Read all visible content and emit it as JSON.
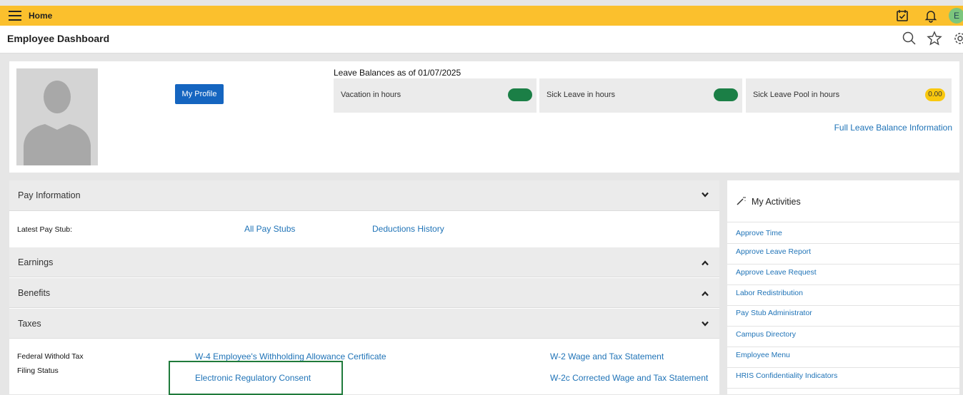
{
  "topbar": {
    "menu_icon": "hamburger-icon",
    "home_label": "Home",
    "avatar_initial": "E"
  },
  "header": {
    "title": "Employee Dashboard",
    "icons": [
      "search-icon",
      "star-icon",
      "gear-icon"
    ]
  },
  "profile": {
    "button_label": "My Profile"
  },
  "leave": {
    "title": "Leave Balances as of 01/07/2025",
    "items": [
      {
        "label": "Vacation in hours",
        "value": ""
      },
      {
        "label": "Sick Leave in hours",
        "value": ""
      },
      {
        "label": "Sick Leave Pool in hours",
        "value": "0.00"
      }
    ],
    "full_link": "Full Leave Balance Information"
  },
  "pay": {
    "title": "Pay Information",
    "latest_label": "Latest Pay Stub:",
    "all_stubs": "All Pay Stubs",
    "deductions": "Deductions History",
    "earnings": "Earnings",
    "benefits": "Benefits",
    "taxes": "Taxes",
    "federal_label": "Federal Withold Tax",
    "filing_label": "Filing Status",
    "w4_link": "W-4 Employee's Withholding Allowance Certificate",
    "consent_link": "Electronic Regulatory Consent",
    "w2_link": "W-2 Wage and Tax Statement",
    "w2c_link": "W-2c Corrected Wage and Tax Statement"
  },
  "activities": {
    "title": "My Activities",
    "items": [
      "Approve Time",
      "Approve Leave Report",
      "Approve Leave Request",
      "Labor Redistribution",
      "Pay Stub Administrator",
      "Campus Directory",
      "Employee Menu",
      "HRIS Confidentiality Indicators"
    ]
  },
  "colors": {
    "topbar": "#fbc02d",
    "link": "#1f73b7",
    "button": "#1565c0",
    "pill_green": "#1b7f46",
    "highlight": "#1f7a3b"
  }
}
